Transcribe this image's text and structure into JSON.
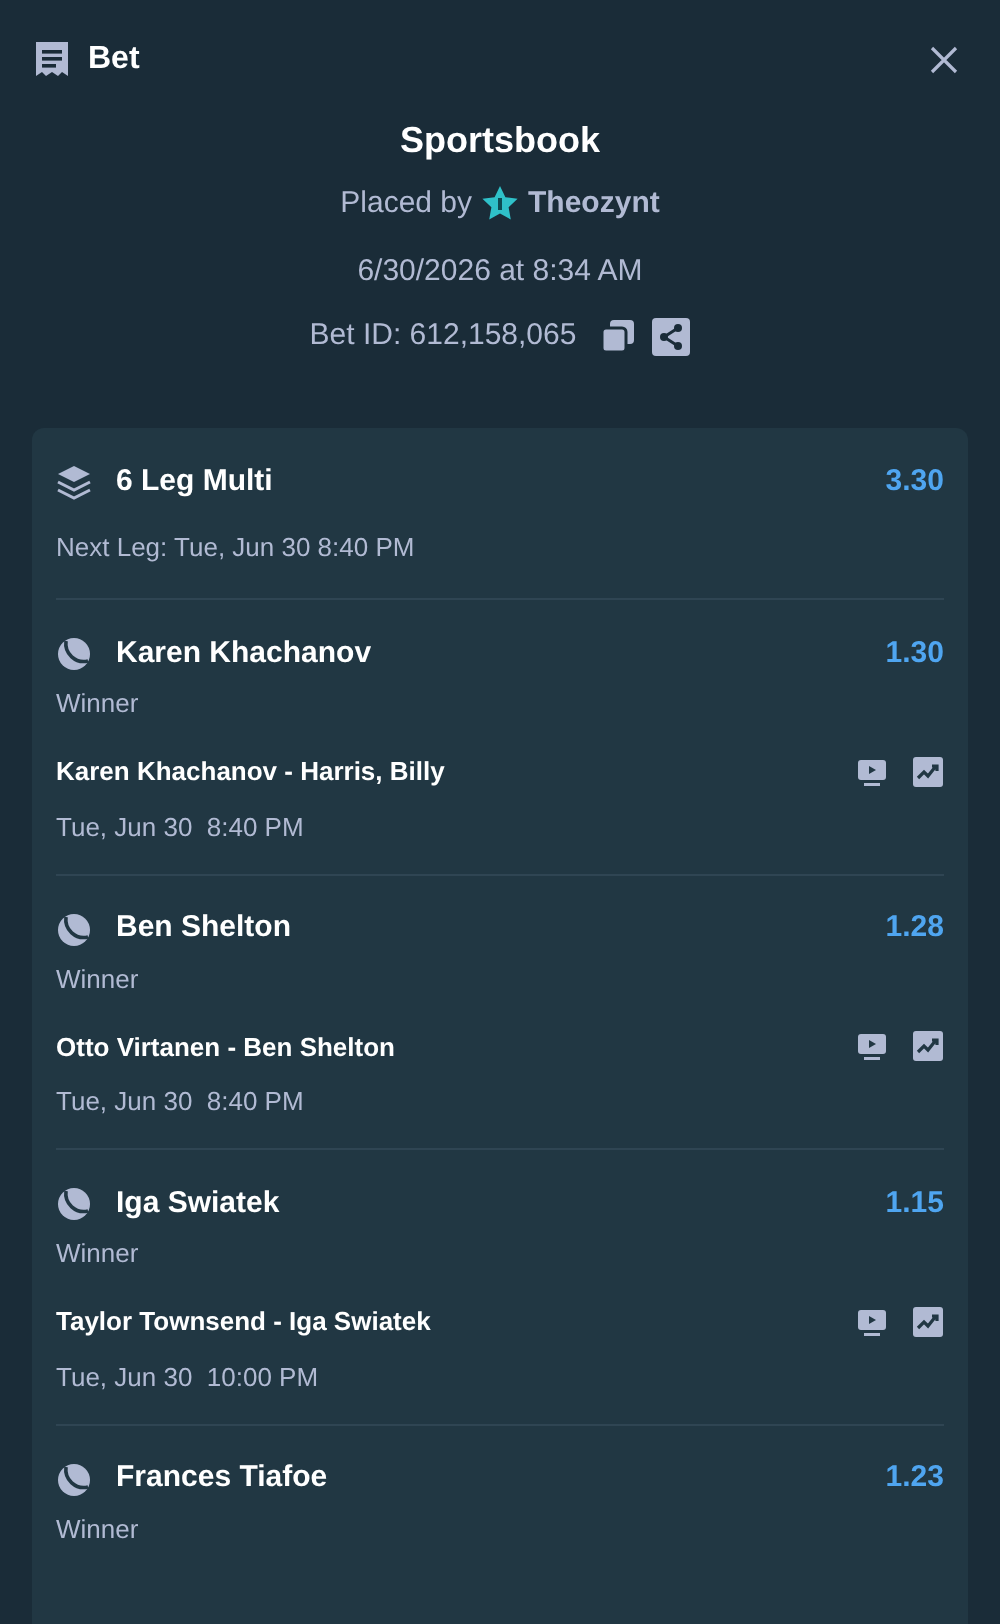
{
  "header": {
    "title": "Bet"
  },
  "summary": {
    "source": "Sportsbook",
    "placed_by_label": "Placed by",
    "user": "Theozynt",
    "placed_at": "6/30/2026 at 8:34 AM",
    "bet_id": "Bet ID: 612,158,065"
  },
  "multi": {
    "title": "6 Leg Multi",
    "odds": "3.30",
    "next_leg": "Next Leg: Tue, Jun 30 8:40 PM"
  },
  "legs": [
    {
      "selection": "Karen Khachanov",
      "odds": "1.30",
      "market": "Winner",
      "match": "Karen Khachanov - Harris, Billy",
      "time": "Tue, Jun 30  8:40 PM"
    },
    {
      "selection": "Ben Shelton",
      "odds": "1.28",
      "market": "Winner",
      "match": "Otto Virtanen - Ben Shelton",
      "time": "Tue, Jun 30  8:40 PM"
    },
    {
      "selection": "Iga Swiatek",
      "odds": "1.15",
      "market": "Winner",
      "match": "Taylor Townsend - Iga Swiatek",
      "time": "Tue, Jun 30  10:00 PM"
    },
    {
      "selection": "Frances Tiafoe",
      "odds": "1.23",
      "market": "Winner"
    }
  ]
}
